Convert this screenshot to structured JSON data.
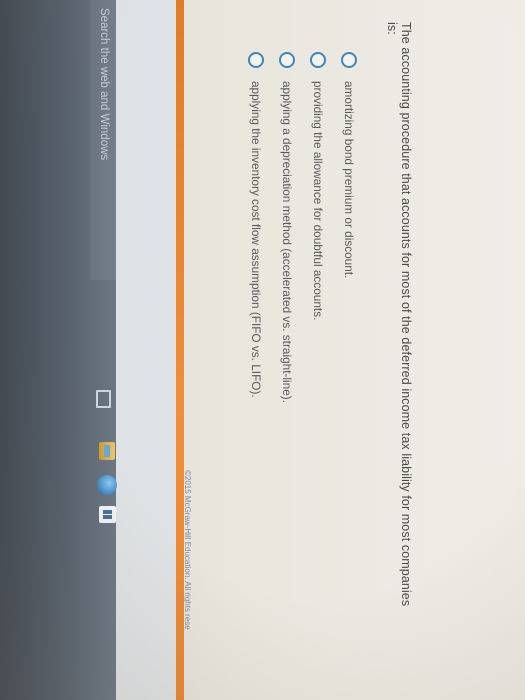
{
  "question": {
    "text": "The accounting procedure that accounts for most of the deferred income tax liability for most companies is:"
  },
  "options": [
    {
      "label": "amortizing bond premium or discount."
    },
    {
      "label": "providing the allowance for doubtful accounts."
    },
    {
      "label": "applying a depreciation method (accelerated vs. straight-line)."
    },
    {
      "label": "applying the inventory cost flow assumption (FIFO vs. LIFO)."
    }
  ],
  "footer": {
    "copyright": "©2015 McGraw-Hill Education. All rights rese"
  },
  "taskbar": {
    "search_placeholder": "Search the web and Windows",
    "icons": [
      "task-view-icon",
      "file-explorer-icon",
      "edge-browser-icon",
      "store-icon"
    ]
  },
  "colors": {
    "radio": "#3e86b8",
    "accent_bar": "#e88530",
    "taskbar": "#4f5964"
  }
}
